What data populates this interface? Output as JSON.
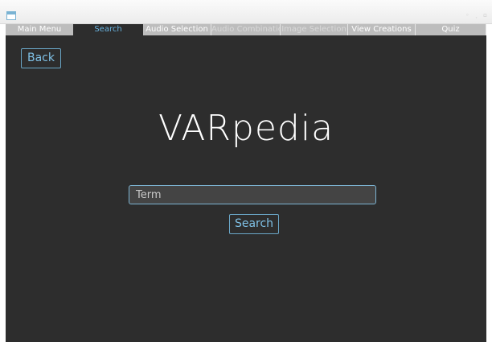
{
  "window": {
    "controls": [
      "◦",
      "˯",
      "▫"
    ]
  },
  "tabs": [
    {
      "label": "Main Menu",
      "state": "normal"
    },
    {
      "label": "Search",
      "state": "selected"
    },
    {
      "label": "Audio Selection",
      "state": "normal"
    },
    {
      "label": "Audio Combination",
      "state": "disabled"
    },
    {
      "label": "Image Selection",
      "state": "disabled"
    },
    {
      "label": "View Creations",
      "state": "normal"
    },
    {
      "label": "Quiz",
      "state": "normal"
    }
  ],
  "search_page": {
    "back_label": "Back",
    "title": "VARpedia",
    "term_placeholder": "Term",
    "term_value": "",
    "search_label": "Search"
  },
  "colors": {
    "content_bg": "#2d2d2d",
    "accent": "#7fc1e6",
    "tab_bg": "#bdbdbd",
    "tab_selected_text": "#6ab4e0"
  }
}
